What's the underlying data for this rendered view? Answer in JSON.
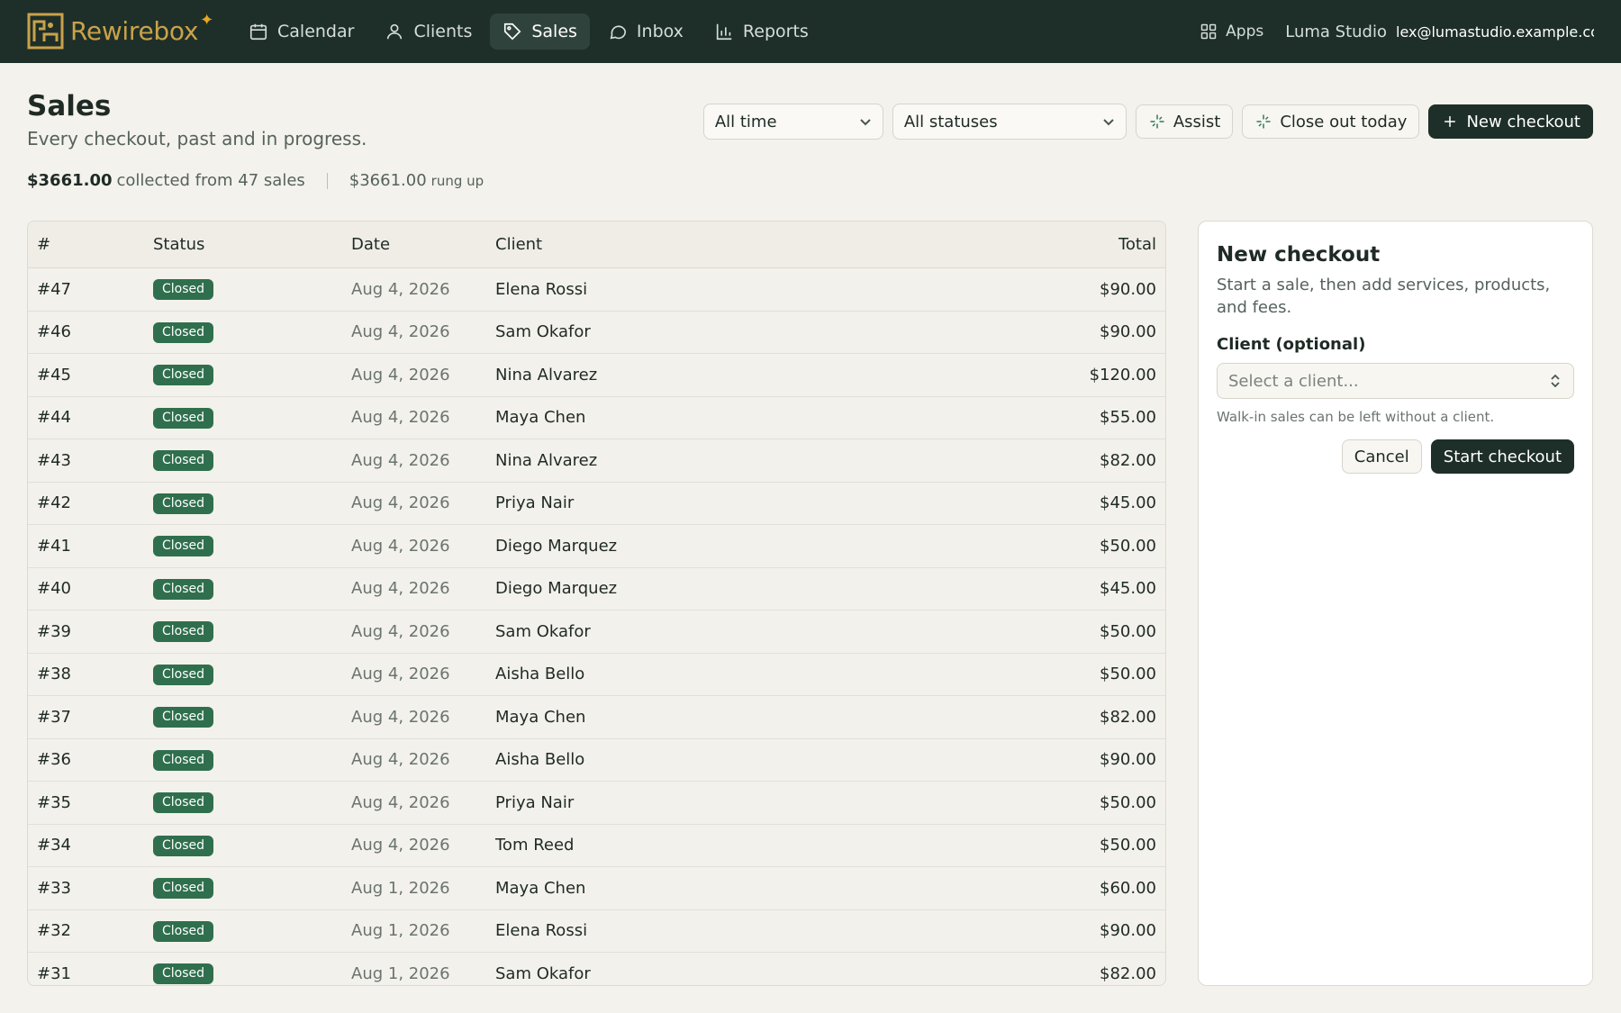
{
  "brand": {
    "name": "Rewirebox"
  },
  "nav": {
    "items": [
      {
        "label": "Calendar",
        "icon": "calendar-icon"
      },
      {
        "label": "Clients",
        "icon": "user-icon"
      },
      {
        "label": "Sales",
        "icon": "tag-icon",
        "active": true
      },
      {
        "label": "Inbox",
        "icon": "chat-bubble-icon"
      },
      {
        "label": "Reports",
        "icon": "bar-chart-icon"
      }
    ],
    "apps_label": "Apps",
    "studio": "Luma Studio",
    "email": "lex@lumastudio.example.com"
  },
  "header": {
    "title": "Sales",
    "subtitle": "Every checkout, past and in progress.",
    "summary": {
      "collected_amount": "$3661.00",
      "collected_text": "collected from 47 sales",
      "rung_amount": "$3661.00",
      "rung_text": "rung up"
    }
  },
  "filters": {
    "time": "All time",
    "status": "All statuses"
  },
  "actions": {
    "assist": "Assist",
    "close_out": "Close out today",
    "new_checkout": "New checkout"
  },
  "table": {
    "columns": {
      "num": "#",
      "status": "Status",
      "date": "Date",
      "client": "Client",
      "total": "Total"
    },
    "rows": [
      {
        "num": "#47",
        "status": "Closed",
        "date": "Aug 4, 2026",
        "client": "Elena Rossi",
        "total": "$90.00"
      },
      {
        "num": "#46",
        "status": "Closed",
        "date": "Aug 4, 2026",
        "client": "Sam Okafor",
        "total": "$90.00"
      },
      {
        "num": "#45",
        "status": "Closed",
        "date": "Aug 4, 2026",
        "client": "Nina Alvarez",
        "total": "$120.00"
      },
      {
        "num": "#44",
        "status": "Closed",
        "date": "Aug 4, 2026",
        "client": "Maya Chen",
        "total": "$55.00"
      },
      {
        "num": "#43",
        "status": "Closed",
        "date": "Aug 4, 2026",
        "client": "Nina Alvarez",
        "total": "$82.00"
      },
      {
        "num": "#42",
        "status": "Closed",
        "date": "Aug 4, 2026",
        "client": "Priya Nair",
        "total": "$45.00"
      },
      {
        "num": "#41",
        "status": "Closed",
        "date": "Aug 4, 2026",
        "client": "Diego Marquez",
        "total": "$50.00"
      },
      {
        "num": "#40",
        "status": "Closed",
        "date": "Aug 4, 2026",
        "client": "Diego Marquez",
        "total": "$45.00"
      },
      {
        "num": "#39",
        "status": "Closed",
        "date": "Aug 4, 2026",
        "client": "Sam Okafor",
        "total": "$50.00"
      },
      {
        "num": "#38",
        "status": "Closed",
        "date": "Aug 4, 2026",
        "client": "Aisha Bello",
        "total": "$50.00"
      },
      {
        "num": "#37",
        "status": "Closed",
        "date": "Aug 4, 2026",
        "client": "Maya Chen",
        "total": "$82.00"
      },
      {
        "num": "#36",
        "status": "Closed",
        "date": "Aug 4, 2026",
        "client": "Aisha Bello",
        "total": "$90.00"
      },
      {
        "num": "#35",
        "status": "Closed",
        "date": "Aug 4, 2026",
        "client": "Priya Nair",
        "total": "$50.00"
      },
      {
        "num": "#34",
        "status": "Closed",
        "date": "Aug 4, 2026",
        "client": "Tom Reed",
        "total": "$50.00"
      },
      {
        "num": "#33",
        "status": "Closed",
        "date": "Aug 1, 2026",
        "client": "Maya Chen",
        "total": "$60.00"
      },
      {
        "num": "#32",
        "status": "Closed",
        "date": "Aug 1, 2026",
        "client": "Elena Rossi",
        "total": "$90.00"
      },
      {
        "num": "#31",
        "status": "Closed",
        "date": "Aug 1, 2026",
        "client": "Sam Okafor",
        "total": "$82.00"
      }
    ]
  },
  "panel": {
    "title": "New checkout",
    "description": "Start a sale, then add services, products, and fees.",
    "client_label": "Client (optional)",
    "client_placeholder": "Select a client...",
    "hint": "Walk-in sales can be left without a client.",
    "cancel": "Cancel",
    "start": "Start checkout"
  },
  "colors": {
    "nav_bg": "#1e2f29",
    "accent_gold": "#c9a24a",
    "badge_green": "#2f6f4e",
    "page_bg": "#f4f2ec"
  }
}
